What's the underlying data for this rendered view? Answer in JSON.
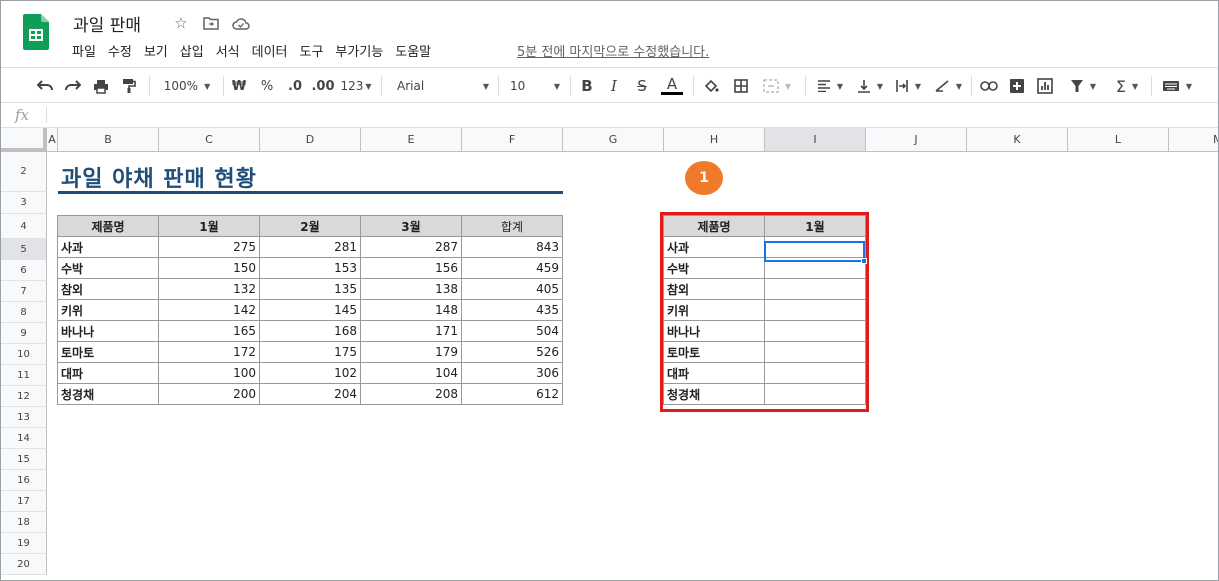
{
  "app": {
    "doc_title": "과일 판매",
    "menu": [
      "파일",
      "수정",
      "보기",
      "삽입",
      "서식",
      "데이터",
      "도구",
      "부가기능",
      "도움말"
    ],
    "last_edit": "5분 전에 마지막으로 수정했습니다.",
    "accent_color": "#0f9d58"
  },
  "toolbar": {
    "zoom": "100%",
    "currency": "₩",
    "percent": "%",
    "decrease_decimal": ".0",
    "increase_decimal": ".00",
    "number_format": "123",
    "font": "Arial",
    "font_size": "10",
    "bold": "B",
    "italic": "I",
    "strike": "S",
    "text_color": "A"
  },
  "formula_bar": {
    "fx": "fx",
    "value": ""
  },
  "grid": {
    "columns": [
      "A",
      "B",
      "C",
      "D",
      "E",
      "F",
      "G",
      "H",
      "I",
      "J",
      "K",
      "L",
      "M"
    ],
    "rows": [
      "2",
      "3",
      "4",
      "5",
      "6",
      "7",
      "8",
      "9",
      "10",
      "11",
      "12",
      "13",
      "14",
      "15",
      "16",
      "17",
      "18",
      "19",
      "20"
    ],
    "active_column": "I",
    "active_row": "5"
  },
  "sheet": {
    "title": "과일 야채 판매 현황",
    "badge": "1",
    "table_a": {
      "headers": [
        "제품명",
        "1월",
        "2월",
        "3월",
        "합계"
      ],
      "rows": [
        [
          "사과",
          "275",
          "281",
          "287",
          "843"
        ],
        [
          "수박",
          "150",
          "153",
          "156",
          "459"
        ],
        [
          "참외",
          "132",
          "135",
          "138",
          "405"
        ],
        [
          "키위",
          "142",
          "145",
          "148",
          "435"
        ],
        [
          "바나나",
          "165",
          "168",
          "171",
          "504"
        ],
        [
          "토마토",
          "172",
          "175",
          "179",
          "526"
        ],
        [
          "대파",
          "100",
          "102",
          "104",
          "306"
        ],
        [
          "청경채",
          "200",
          "204",
          "208",
          "612"
        ]
      ]
    },
    "table_b": {
      "headers": [
        "제품명",
        "1월"
      ],
      "rows": [
        [
          "사과",
          ""
        ],
        [
          "수박",
          ""
        ],
        [
          "참외",
          ""
        ],
        [
          "키위",
          ""
        ],
        [
          "바나나",
          ""
        ],
        [
          "토마토",
          ""
        ],
        [
          "대파",
          ""
        ],
        [
          "청경채",
          ""
        ]
      ]
    }
  }
}
